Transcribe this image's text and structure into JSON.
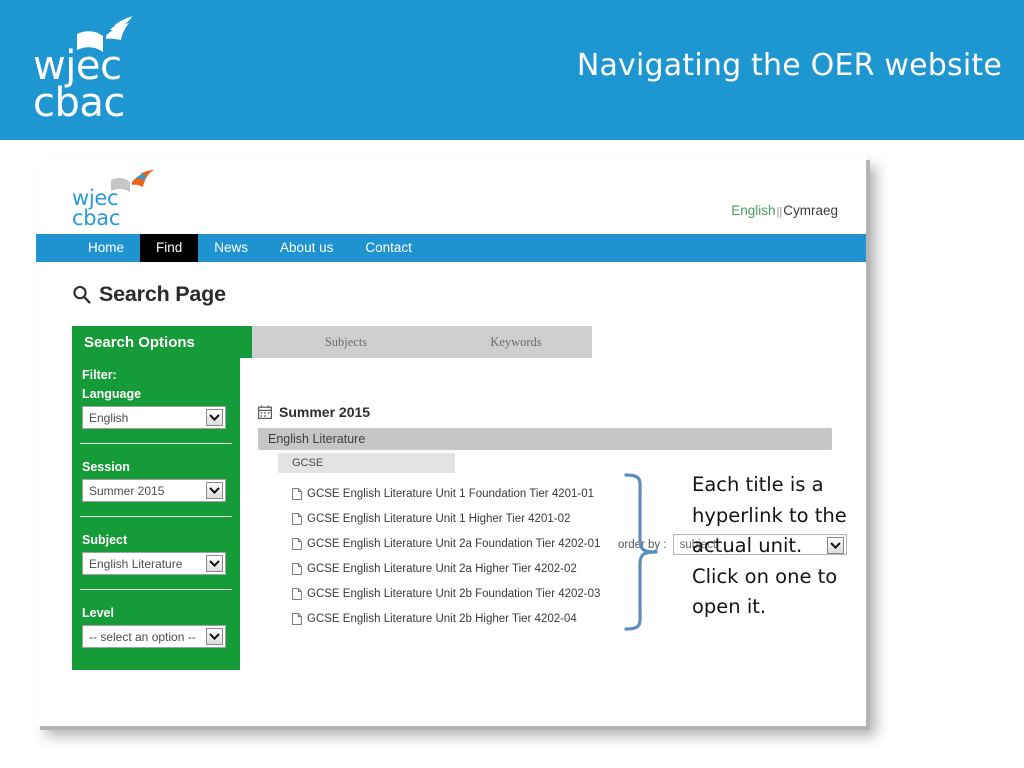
{
  "slide": {
    "title": "Navigating the OER website",
    "logo_line1": "wjec",
    "logo_line2": "cbac",
    "banner_color": "#1e96d2"
  },
  "screenshot": {
    "site_logo": {
      "line1": "wjec",
      "line2": "cbac",
      "color": "#2b9ad6"
    },
    "language_switch": {
      "english": "English",
      "separator": "||",
      "welsh": "Cymraeg",
      "english_color": "#4a9b5e"
    },
    "nav": {
      "items": [
        {
          "label": "Home",
          "active": false
        },
        {
          "label": "Find",
          "active": true
        },
        {
          "label": "News",
          "active": false
        },
        {
          "label": "About us",
          "active": false
        },
        {
          "label": "Contact",
          "active": false
        }
      ],
      "bar_color": "#1f93cf",
      "active_color": "#000000"
    },
    "page_title": "Search Page",
    "steps": [
      {
        "label": "Search Options",
        "active": true
      },
      {
        "label": "Subjects",
        "active": false
      },
      {
        "label": "Keywords",
        "active": false
      }
    ],
    "sidebar": {
      "heading": "Filter:",
      "accent_color": "#159b37",
      "fields": [
        {
          "label": "Language",
          "value": "English"
        },
        {
          "label": "Session",
          "value": "Summer 2015"
        },
        {
          "label": "Subject",
          "value": "English Literature"
        },
        {
          "label": "Level",
          "value": "-- select an option --"
        }
      ]
    },
    "order_by": {
      "label": "order by :",
      "value": "subject"
    },
    "results": {
      "season": "Summer 2015",
      "subject_band": "English Literature",
      "level_band": "GCSE",
      "items": [
        "GCSE English Literature Unit 1 Foundation Tier 4201-01",
        "GCSE English Literature Unit 1 Higher Tier 4201-02",
        "GCSE English Literature Unit 2a Foundation Tier 4202-01",
        "GCSE English Literature Unit 2a Higher Tier 4202-02",
        "GCSE English Literature Unit 2b Foundation Tier 4202-03",
        "GCSE English Literature Unit 2b Higher Tier 4202-04"
      ]
    }
  },
  "annotation": {
    "text": "Each title is a hyperlink to the actual unit. Click on one to open it.",
    "brace_color": "#5b8dbe"
  }
}
